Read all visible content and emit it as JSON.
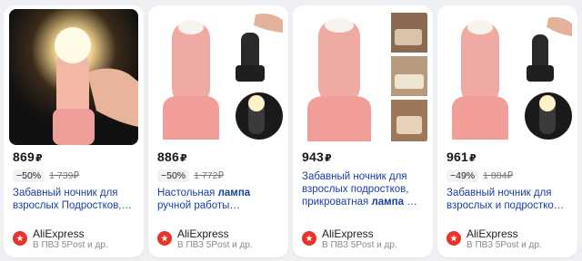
{
  "products": [
    {
      "price": "869",
      "currency": "₽",
      "discount": "−50%",
      "old_price": "1 739₽",
      "title_parts": [
        {
          "text": "Забавный ночник для взрослых Подростков,…",
          "bold": false
        }
      ],
      "shop": "AliExpress",
      "delivery": "В ПВЗ 5Post и др.",
      "image_icon": "glowing-night-lamp-in-hand-image"
    },
    {
      "price": "886",
      "currency": "₽",
      "discount": "−50%",
      "old_price": "1 772₽",
      "title_parts": [
        {
          "text": "Настольная ",
          "bold": false
        },
        {
          "text": "лампа",
          "bold": true
        },
        {
          "text": " ручной работы…",
          "bold": false
        }
      ],
      "shop": "AliExpress",
      "delivery": "В ПВЗ 5Post и др.",
      "image_icon": "pink-lamp-with-variants-image"
    },
    {
      "price": "943",
      "currency": "₽",
      "discount": "",
      "old_price": "",
      "title_parts": [
        {
          "text": "Забавный ночник для взрослых подростков, прикроватная ",
          "bold": false
        },
        {
          "text": "лампа",
          "bold": true
        },
        {
          "text": " …",
          "bold": false
        }
      ],
      "shop": "AliExpress",
      "delivery": "В ПВЗ 5Post и др.",
      "image_icon": "pink-lamp-with-bedroom-photos-image"
    },
    {
      "price": "961",
      "currency": "₽",
      "discount": "−49%",
      "old_price": "1 884₽",
      "title_parts": [
        {
          "text": "Забавный ночник для взрослых и подростко…",
          "bold": false
        }
      ],
      "shop": "AliExpress",
      "delivery": "В ПВЗ 5Post и др.",
      "image_icon": "pink-lamp-with-black-variant-image"
    }
  ],
  "colors": {
    "title_link": "#1b3fa0",
    "lamp_pink": "#f0a8a3",
    "aliexpress_red": "#e8332a"
  }
}
